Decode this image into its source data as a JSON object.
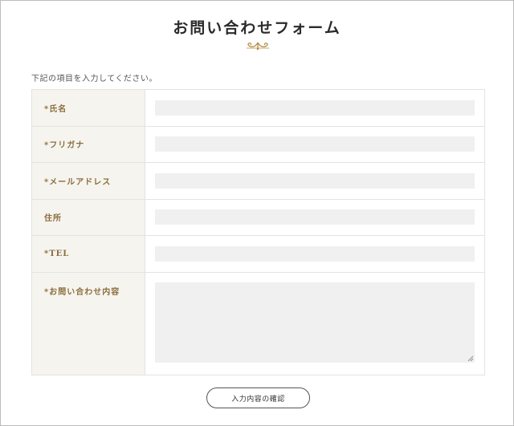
{
  "page": {
    "title": "お問い合わせフォーム",
    "intro": "下記の項目を入力してください。"
  },
  "form": {
    "fields": [
      {
        "label": "*氏名",
        "type": "text",
        "value": ""
      },
      {
        "label": "*フリガナ",
        "type": "text",
        "value": ""
      },
      {
        "label": "*メールアドレス",
        "type": "text",
        "value": ""
      },
      {
        "label": "住所",
        "type": "text",
        "value": ""
      },
      {
        "label": "*TEL",
        "type": "text",
        "value": ""
      },
      {
        "label": "*お問い合わせ内容",
        "type": "textarea",
        "value": ""
      }
    ],
    "submit_label": "入力内容の確認"
  },
  "colors": {
    "label_text": "#8a6d3b",
    "label_bg": "#f6f4ef",
    "input_bg": "#f0f0f0",
    "ornament": "#b0883b"
  },
  "icons": {
    "ornament": "flourish-ornament-icon",
    "resize": "resize-grip-icon"
  }
}
